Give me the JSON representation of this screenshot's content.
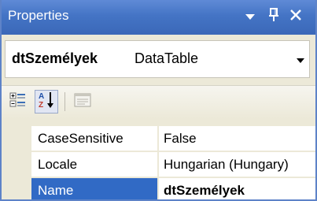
{
  "window": {
    "title": "Properties",
    "buttons": {
      "dropdown_icon": "chevron-down-icon",
      "pin_icon": "pin-icon",
      "close_icon": "close-icon"
    }
  },
  "object_selector": {
    "name": "dtSzemélyek",
    "type": "DataTable"
  },
  "toolbar": {
    "categorized_icon": "categorized-icon",
    "alphabetical_icon": "alphabetical-icon",
    "property_pages_icon": "property-pages-icon"
  },
  "properties": [
    {
      "name": "CaseSensitive",
      "value": "False"
    },
    {
      "name": "Locale",
      "value": "Hungarian (Hungary)"
    },
    {
      "name": "Name",
      "value": "dtSzemélyek",
      "selected": true
    }
  ],
  "colors": {
    "titlebar": "#4474c5",
    "selection": "#316ac5",
    "panel_bg": "#ece9d8"
  }
}
